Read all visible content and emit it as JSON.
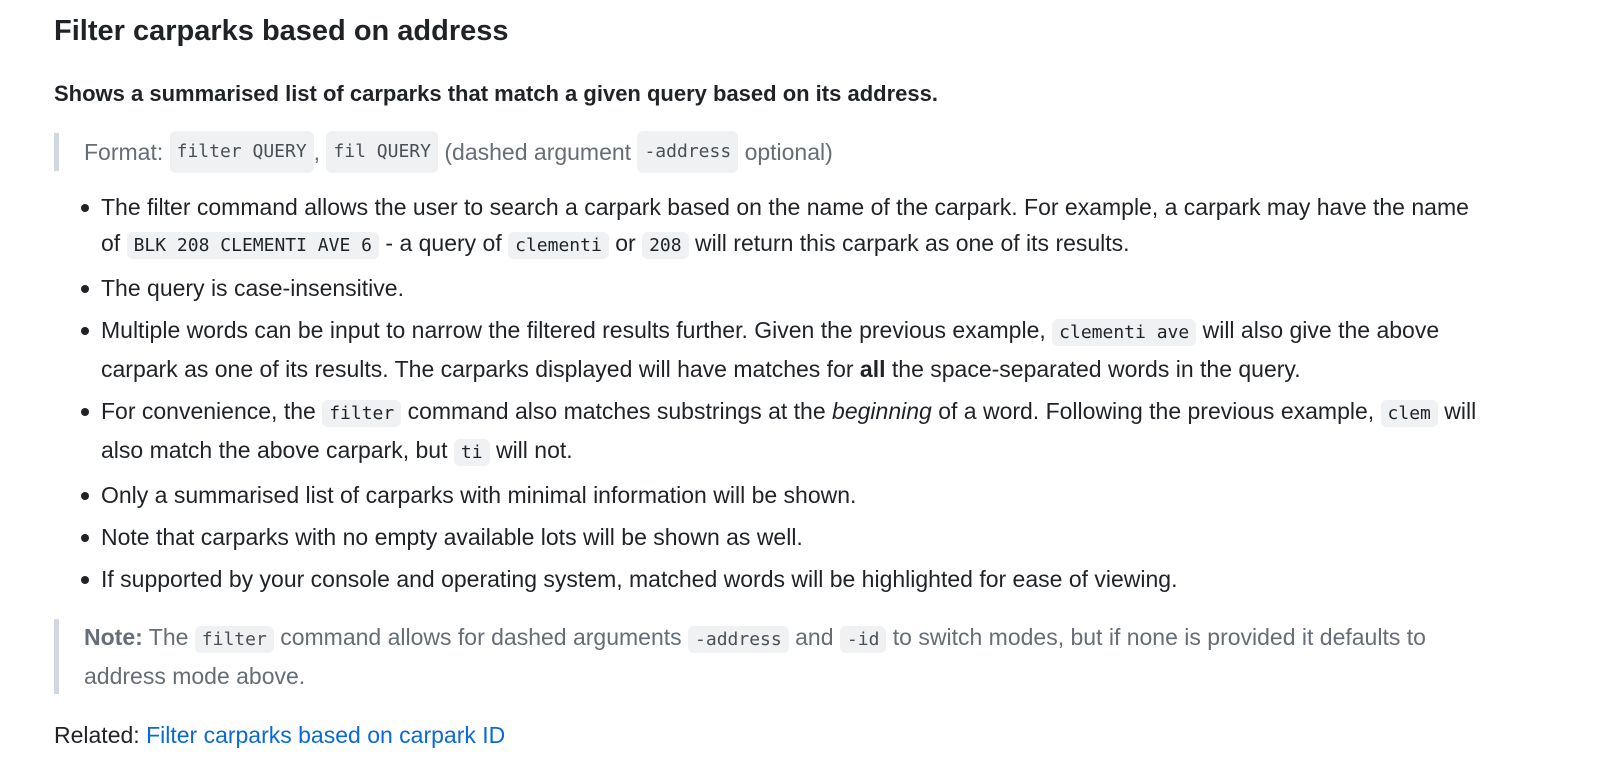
{
  "heading": "Filter carparks based on address",
  "lead": "Shows a summarised list of carparks that match a given query based on its address.",
  "format_block": {
    "prefix": "Format:",
    "cmd1": "filter QUERY",
    "sep": ",",
    "cmd2": "fil QUERY",
    "mid": "(dashed argument",
    "arg": "-address",
    "suffix": "optional)"
  },
  "bullets": {
    "b1": {
      "t1": "The filter command allows the user to search a carpark based on the name of the carpark. For example, a carpark may have the name of",
      "c1": "BLK 208 CLEMENTI AVE 6",
      "t2": "- a query of",
      "c2": "clementi",
      "t3": "or",
      "c3": "208",
      "t4": "will return this carpark as one of its results."
    },
    "b2": {
      "t1": "The query is case-insensitive."
    },
    "b3": {
      "t1": "Multiple words can be input to narrow the filtered results further. Given the previous example,",
      "c1": "clementi ave",
      "t2": "will also give the above carpark as one of its results. The carparks displayed will have matches for",
      "strong": "all",
      "t3": "the space-separated words in the query."
    },
    "b4": {
      "t1": "For convenience, the",
      "c1": "filter",
      "t2": "command also matches substrings at the",
      "em": "beginning",
      "t3": "of a word. Following the previous example,",
      "c2": "clem",
      "t4": "will also match the above carpark, but",
      "c3": "ti",
      "t5": "will not."
    },
    "b5": {
      "t1": "Only a summarised list of carparks with minimal information will be shown."
    },
    "b6": {
      "t1": "Note that carparks with no empty available lots will be shown as well."
    },
    "b7": {
      "t1": "If supported by your console and operating system, matched words will be highlighted for ease of viewing."
    }
  },
  "note_block": {
    "label": "Note:",
    "t1": "The",
    "c1": "filter",
    "t2": "command allows for dashed arguments",
    "c2": "-address",
    "t3": "and",
    "c3": "-id",
    "t4": "to switch modes, but if none is provided it defaults to address mode above."
  },
  "related": {
    "label": "Related:",
    "link": "Filter carparks based on carpark ID"
  },
  "colors": {
    "text": "#1f2328",
    "muted": "#656d76",
    "link": "#0969da",
    "code_bg": "#eff1f3",
    "quote_border": "#d0d7de"
  }
}
